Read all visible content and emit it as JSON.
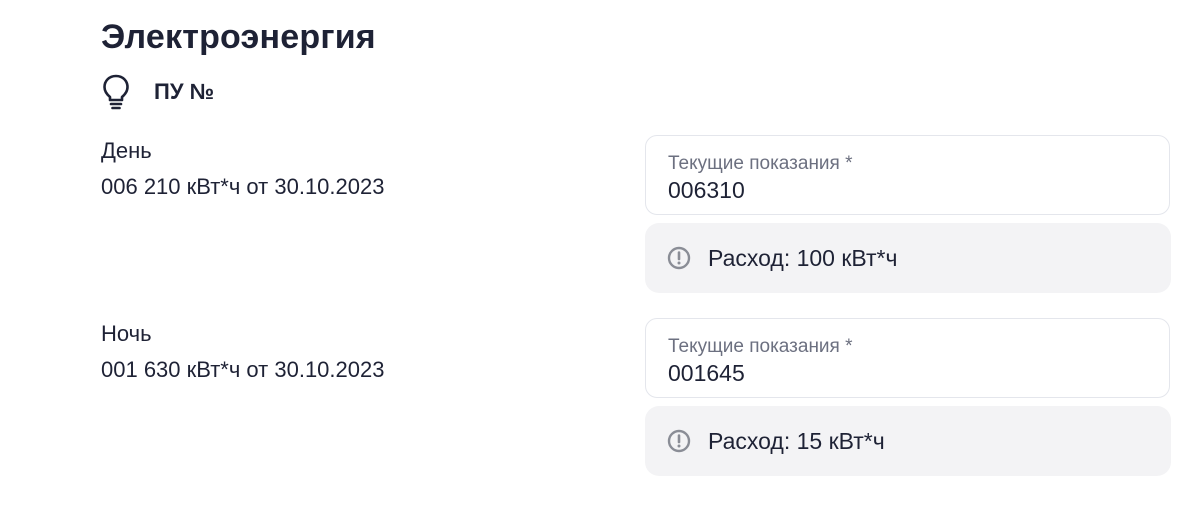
{
  "header": {
    "title": "Электроэнергия",
    "meter_label": "ПУ №",
    "meter_icon": "lightbulb-icon"
  },
  "readings": [
    {
      "tariff": "День",
      "previous": "006 210 кВт*ч от 30.10.2023",
      "field_label": "Текущие показания  *",
      "current_value": "006310",
      "usage": "Расход: 100 кВт*ч",
      "usage_icon": "info-circle-icon"
    },
    {
      "tariff": "Ночь",
      "previous": "001 630 кВт*ч от 30.10.2023",
      "field_label": "Текущие показания  *",
      "current_value": "001645",
      "usage": "Расход: 15 кВт*ч",
      "usage_icon": "info-circle-icon"
    }
  ],
  "colors": {
    "text": "#1e2235",
    "muted": "#6c7080",
    "border": "#e4e6ec",
    "usage_bg": "#f3f3f5",
    "icon": "#8a8d96"
  }
}
